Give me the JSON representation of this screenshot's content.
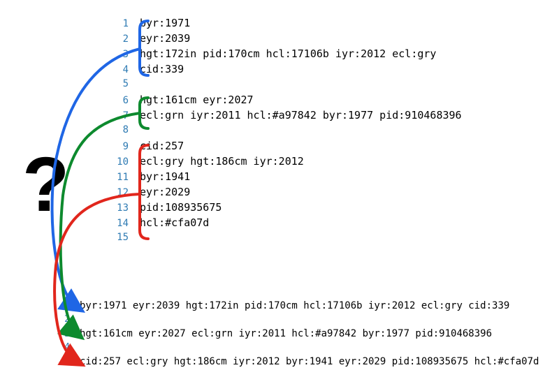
{
  "question_mark": "?",
  "code": {
    "lines": [
      {
        "n": "1",
        "text": "byr:1971"
      },
      {
        "n": "2",
        "text": "eyr:2039"
      },
      {
        "n": "3",
        "text": "hgt:172in pid:170cm hcl:17106b iyr:2012 ecl:gry"
      },
      {
        "n": "4",
        "text": "cid:339"
      },
      {
        "n": "5",
        "text": ""
      },
      {
        "n": "6",
        "text": "hgt:161cm eyr:2027"
      },
      {
        "n": "7",
        "text": "ecl:grn iyr:2011 hcl:#a97842 byr:1977 pid:910468396"
      },
      {
        "n": "8",
        "text": ""
      },
      {
        "n": "9",
        "text": "cid:257"
      },
      {
        "n": "10",
        "text": "ecl:gry hgt:186cm iyr:2012"
      },
      {
        "n": "11",
        "text": "byr:1941"
      },
      {
        "n": "12",
        "text": "eyr:2029"
      },
      {
        "n": "13",
        "text": "pid:108935675"
      },
      {
        "n": "14",
        "text": "hcl:#cfa07d"
      },
      {
        "n": "15",
        "text": ""
      }
    ]
  },
  "output": {
    "lines": [
      {
        "n": "1",
        "text": "byr:1971 eyr:2039 hgt:172in pid:170cm hcl:17106b iyr:2012 ecl:gry cid:339"
      },
      {
        "n": "2",
        "text": ""
      },
      {
        "n": "3",
        "text": "hgt:161cm eyr:2027 ecl:grn iyr:2011 hcl:#a97842 byr:1977 pid:910468396"
      },
      {
        "n": "4",
        "text": ""
      },
      {
        "n": "5",
        "text": "cid:257 ecl:gry hgt:186cm iyr:2012 byr:1941 eyr:2029 pid:108935675 hcl:#cfa07d"
      }
    ]
  },
  "annotations": {
    "colors": {
      "blue": "#1f66e5",
      "green": "#0d8a2e",
      "red": "#e1261c"
    }
  }
}
